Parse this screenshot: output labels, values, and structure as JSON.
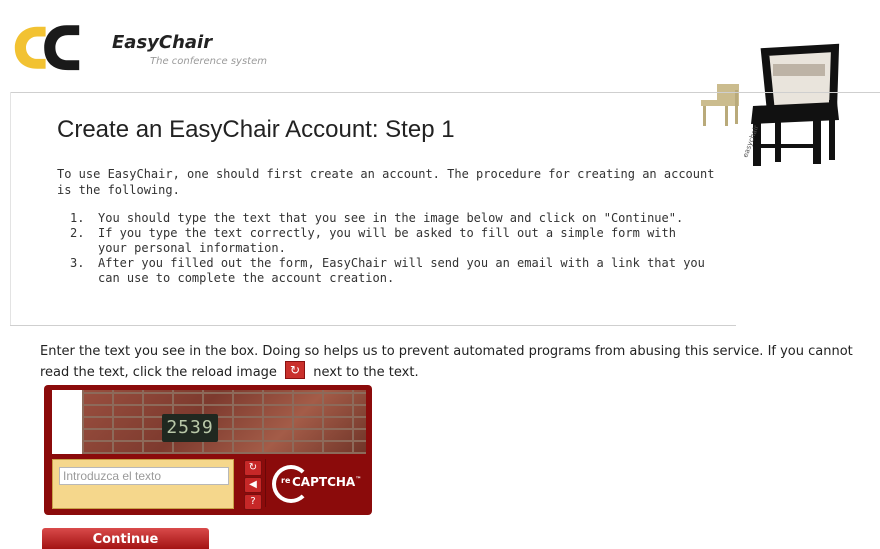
{
  "brand": {
    "name": "EasyChair",
    "tagline": "The conference system",
    "chair_caption": "easychair"
  },
  "main": {
    "title": "Create an EasyChair Account: Step 1",
    "intro": "To use EasyChair, one should first create an account. The procedure for creating an account is the following.",
    "steps": [
      {
        "num": "1.",
        "text": "You should type the text that you see in the image below and click on \"Continue\"."
      },
      {
        "num": "2.",
        "text": "If you type the text correctly, you will be asked to fill out a simple form with your personal information."
      },
      {
        "num": "3.",
        "text": "After you filled out the form, EasyChair will send you an email with a link that you can use to complete the account creation."
      }
    ]
  },
  "captcha": {
    "instructions_before": "Enter the text you see in the box. Doing so helps us to prevent automated programs from abusing this service. If you cannot read the text, click the reload image",
    "instructions_after": "next to the text.",
    "image_text": "2539",
    "input_placeholder": "Introduzca el texto",
    "input_value": "",
    "logo_prefix": "re",
    "logo_word": "CAPTCHA",
    "logo_tm": "™",
    "reload_glyph": "↻",
    "audio_glyph": "◀",
    "help_glyph": "?"
  },
  "actions": {
    "continue_label": "Continue"
  },
  "colors": {
    "captcha_background": "#8b0b0b",
    "captcha_input_area": "#f5d78c",
    "continue_button": "#c62828"
  },
  "icons": {
    "logo": "easychair-logo-icon",
    "chair": "chair-illustration-icon",
    "reload": "reload-icon",
    "audio": "audio-icon",
    "help": "help-icon"
  }
}
